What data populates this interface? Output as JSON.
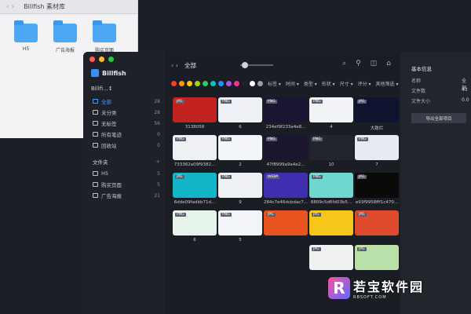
{
  "finder": {
    "nav": "‹  ›",
    "title": "Billfish 素材库",
    "folders": [
      "H5",
      "广告海报",
      "购买页面"
    ]
  },
  "app": {
    "brand": "Billfish",
    "library": "Billfi...↕",
    "sidebar_items": [
      {
        "label": "全部",
        "count": "28"
      },
      {
        "label": "未分类",
        "count": "28"
      },
      {
        "label": "无标签",
        "count": "56"
      },
      {
        "label": "所有笔迹",
        "count": "0"
      },
      {
        "label": "回收站",
        "count": "0"
      }
    ],
    "folder_section": "文件夹",
    "folder_section_plus": "+",
    "folder_items": [
      {
        "label": "H5",
        "count": "5"
      },
      {
        "label": "购买页面",
        "count": "5"
      },
      {
        "label": "广告海报",
        "count": "21"
      }
    ],
    "topbar": {
      "nav": "‹  ›",
      "title": "全部"
    },
    "tools": [
      "⌕",
      "⚲",
      "◫",
      "⌂"
    ],
    "colors": [
      "#ff3b30",
      "#ff9500",
      "#ffcc00",
      "#a4d00c",
      "#34c759",
      "#00c7be",
      "#1e90ff",
      "#af52de",
      "#ff2d92",
      "#222222",
      "#ffffff",
      "#9aa0aa"
    ],
    "filters": [
      "标签 ▾",
      "时间 ▾",
      "类型 ▾",
      "形状 ▾",
      "尺寸 ▾",
      "评分 ▾",
      "其他筛选 ▾"
    ],
    "cards": [
      {
        "cap": "3138058",
        "tag": "JPG",
        "bg": "#c2231f"
      },
      {
        "cap": "6",
        "tag": "PNG",
        "bg": "#eef0f5"
      },
      {
        "cap": "234ef9f233a4e8...",
        "tag": "PNG",
        "bg": "#1a1530"
      },
      {
        "cap": "4",
        "tag": "PNG",
        "bg": "#f1f3f6"
      },
      {
        "cap": "大致烂",
        "tag": "JPG",
        "bg": "#0e1430"
      },
      {
        "cap": "733362a09f9382...",
        "tag": "PNG",
        "bg": "#eef0f3"
      },
      {
        "cap": "2",
        "tag": "PNG",
        "bg": "#f4f5f8"
      },
      {
        "cap": "47f8999a9a4e2...",
        "tag": "PNG",
        "bg": "#1c1530"
      },
      {
        "cap": "10",
        "tag": "PNG",
        "bg": "#22252e"
      },
      {
        "cap": "7",
        "tag": "PNG",
        "bg": "#e7ebf1"
      },
      {
        "cap": "6dde09fadbb71d...",
        "tag": "JPG",
        "bg": "#13b6c8"
      },
      {
        "cap": "9",
        "tag": "PNG",
        "bg": "#eef0f4"
      },
      {
        "cap": "284c7e46dcbdac7...",
        "tag": "WEBP",
        "bg": "#3f2fb0"
      },
      {
        "cap": "8809c5d6fd03b5...",
        "tag": "PNG",
        "bg": "#6fd6d0"
      },
      {
        "cap": "e93f9958fff1c470...",
        "tag": "JPG",
        "bg": "#0a0a0a"
      },
      {
        "cap": "6",
        "tag": "PNG",
        "bg": "#e6f3ea"
      },
      {
        "cap": "5",
        "tag": "PNG",
        "bg": "#f3f4f7"
      },
      {
        "cap": "",
        "tag": "JPG",
        "bg": "#e8531f"
      },
      {
        "cap": "",
        "tag": "JPG",
        "bg": "#f7c61a"
      },
      {
        "cap": "",
        "tag": "JPG",
        "bg": "#e04a2c"
      },
      {
        "cap": "",
        "tag": "JPG",
        "bg": "#eef0f2"
      },
      {
        "cap": "",
        "tag": "JPG",
        "bg": "#b8e0a8"
      }
    ],
    "panel": {
      "heading": "基本信息",
      "rows": [
        {
          "label": "名称",
          "value": "全部"
        },
        {
          "label": "文件数",
          "value": "43"
        },
        {
          "label": "文件大小",
          "value": "0.0"
        }
      ],
      "export_label": "导出全部项目"
    }
  },
  "watermark": {
    "logo": "R",
    "name": "若宝软件园",
    "url": "RBSOFT.COM"
  }
}
